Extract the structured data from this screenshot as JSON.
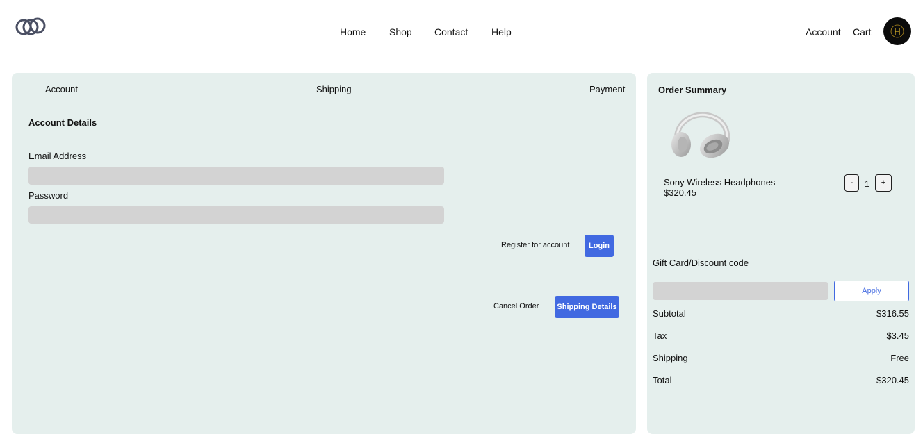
{
  "header": {
    "logo_icon": "interlinked-rings-logo",
    "nav": [
      "Home",
      "Shop",
      "Contact",
      "Help"
    ],
    "account": "Account",
    "cart": "Cart",
    "avatar_icon": "brand-avatar"
  },
  "steps": {
    "account": "Account",
    "shipping": "Shipping",
    "payment": "Payment"
  },
  "account_form": {
    "title": "Account Details",
    "email_label": "Email Address",
    "email_value": "",
    "password_label": "Password",
    "password_value": "",
    "register_label": "Register for account",
    "login_label": "Login",
    "cancel_label": "Cancel Order",
    "next_label": "Shipping Details"
  },
  "summary": {
    "title": "Order Summary",
    "product": {
      "image_icon": "headphones-image",
      "name": "Sony Wireless Headphones",
      "price": "$320.45",
      "quantity": "1",
      "minus_label": "-",
      "plus_label": "+"
    },
    "gift_label": "Gift Card/Discount code",
    "gift_value": "",
    "apply_label": "Apply",
    "rows": [
      {
        "label": "Subtotal",
        "value": "$316.55"
      },
      {
        "label": "Tax",
        "value": "$3.45"
      },
      {
        "label": "Shipping",
        "value": "Free"
      },
      {
        "label": "Total",
        "value": "$320.45"
      }
    ]
  },
  "colors": {
    "panel_bg": "#e5efed",
    "accent": "#4169e1",
    "field_bg": "#d3d3d3"
  }
}
